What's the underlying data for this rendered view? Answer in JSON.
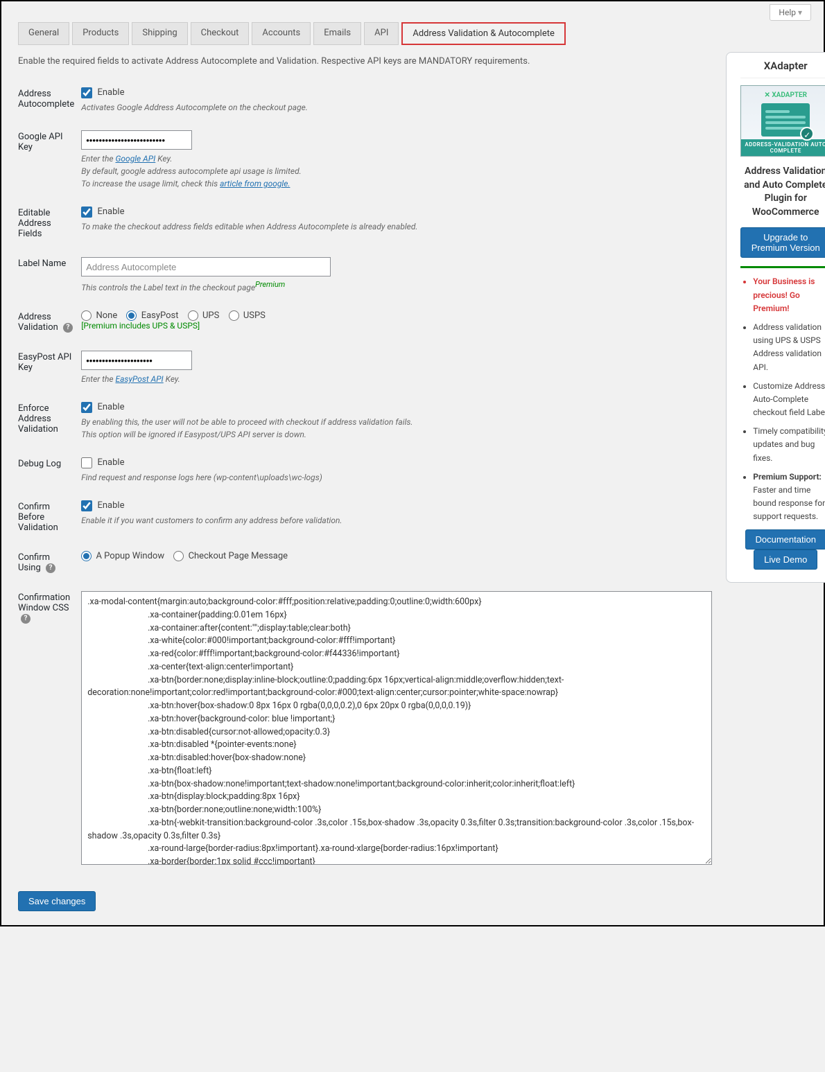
{
  "help_label": "Help",
  "tabs": {
    "general": "General",
    "products": "Products",
    "shipping": "Shipping",
    "checkout": "Checkout",
    "accounts": "Accounts",
    "emails": "Emails",
    "api": "API",
    "active": "Address Validation & Autocomplete"
  },
  "intro": "Enable the required fields to activate Address Autocomplete and Validation. Respective API keys are MANDATORY requirements.",
  "f": {
    "autocomplete": {
      "label": "Address Autocomplete",
      "chk": "Enable",
      "desc": "Activates Google Address Autocomplete on the checkout page."
    },
    "google": {
      "label": "Google API Key",
      "value": "•••••••••••••••••••••••••",
      "d1a": "Enter the ",
      "d1link": "Google API",
      "d1b": " Key.",
      "d2": "By default, google address autocomplete api usage is limited.",
      "d3a": "To increase the usage limit, check this ",
      "d3link": "article from google."
    },
    "editable": {
      "label": "Editable Address Fields",
      "chk": "Enable",
      "desc": "To make the checkout address fields editable when Address Autocomplete is already enabled."
    },
    "labelname": {
      "label": "Label Name",
      "placeholder": "Address Autocomplete",
      "desc_a": "This controls the Label text in the checkout page",
      "premium": "Premium"
    },
    "validation": {
      "label": "Address Validation",
      "none": "None",
      "easypost": "EasyPost",
      "ups": "UPS",
      "usps": "USPS",
      "note": "[Premium includes UPS & USPS]"
    },
    "easypost": {
      "label": "EasyPost API Key",
      "value": "•••••••••••••••••••••",
      "d1a": "Enter the ",
      "d1link": "EasyPost API",
      "d1b": " Key."
    },
    "enforce": {
      "label": "Enforce Address Validation",
      "chk": "Enable",
      "d1": "By enabling this, the user will not be able to proceed with checkout if address validation fails.",
      "d2": "This option will be ignored if Easypost/UPS API server is down."
    },
    "debug": {
      "label": "Debug Log",
      "chk": "Enable",
      "desc": "Find request and response logs here (wp-content\\uploads\\wc-logs)"
    },
    "confirm_before": {
      "label": "Confirm Before Validation",
      "chk": "Enable",
      "desc": "Enable it if you want customers to confirm any address before validation."
    },
    "confirm_using": {
      "label": "Confirm Using",
      "popup": "A Popup Window",
      "msg": "Checkout Page Message"
    },
    "css": {
      "label": "Confirmation Window CSS",
      "text": ".xa-modal-content{margin:auto;background-color:#fff;position:relative;padding:0;outline:0;width:600px}\n                            .xa-container{padding:0.01em 16px}\n                            .xa-container:after{content:\"\";display:table;clear:both}\n                            .xa-white{color:#000!important;background-color:#fff!important}\n                            .xa-red{color:#fff!important;background-color:#f44336!important}\n                            .xa-center{text-align:center!important}\n                            .xa-btn{border:none;display:inline-block;outline:0;padding:6px 16px;vertical-align:middle;overflow:hidden;text-decoration:none!important;color:red!important;background-color:#000;text-align:center;cursor:pointer;white-space:nowrap}\n                            .xa-btn:hover{box-shadow:0 8px 16px 0 rgba(0,0,0,0.2),0 6px 20px 0 rgba(0,0,0,0.19)}\n                            .xa-btn:hover{background-color: blue !important;}\n                            .xa-btn:disabled{cursor:not-allowed;opacity:0.3}\n                            .xa-btn:disabled *{pointer-events:none}\n                            .xa-btn:disabled:hover{box-shadow:none}\n                            .xa-btn{float:left}\n                            .xa-btn{box-shadow:none!important;text-shadow:none!important;background-color:inherit;color:inherit;float:left}\n                            .xa-btn{display:block;padding:8px 16px}\n                            .xa-btn{border:none;outline:none;width:100%}\n                            .xa-btn{-webkit-transition:background-color .3s,color .15s,box-shadow .3s,opacity 0.3s,filter 0.3s;transition:background-color .3s,color .15s,box-shadow .3s,opacity 0.3s,filter 0.3s}\n                            .xa-round-large{border-radius:8px!important}.xa-round-xlarge{border-radius:16px!important}\n                            .xa-border{border:1px solid #ccc!important}\n                            @media (max-width:600px){.xa-modal-content{margin:0 10px;width:auto!important}.xa-modal{padding-top:30px}}\n                            @media (max-width:768px){.xa-modal-content{width:500px}.xa-modal{padding-top:50px}}\n                            @media (min-width:993px){.xa-modal-content{width:900px}}\n                            .xa-closebtn{-webkit-transition:background-color .3s,color .15s,box-shadow .3s,opacity 0.3s,filter 0.3s;transition:background-color .3s,color .15s,box-shadow .3s,opacity 0.3s,filter 0.3s}"
    }
  },
  "save": "Save changes",
  "sidebar": {
    "title": "XAdapter",
    "subtitle": "Address Validation and Auto Complete Plugin for WooCommerce",
    "upgrade": "Upgrade to Premium Version",
    "promo_text": "ADDRESS-VALIDATION AUTO COMPLETE",
    "logo_text": "XADAPTER",
    "go_premium": "Your Business is precious! Go Premium!",
    "li1": "Address validation using UPS & USPS Address validation API.",
    "li2": "Customize Address Auto-Complete checkout field Label.",
    "li3": "Timely compatibility updates and bug fixes.",
    "li4_b": "Premium Support:",
    "li4_r": " Faster and time bound response for support requests.",
    "doc": "Documentation",
    "demo": "Live Demo"
  }
}
